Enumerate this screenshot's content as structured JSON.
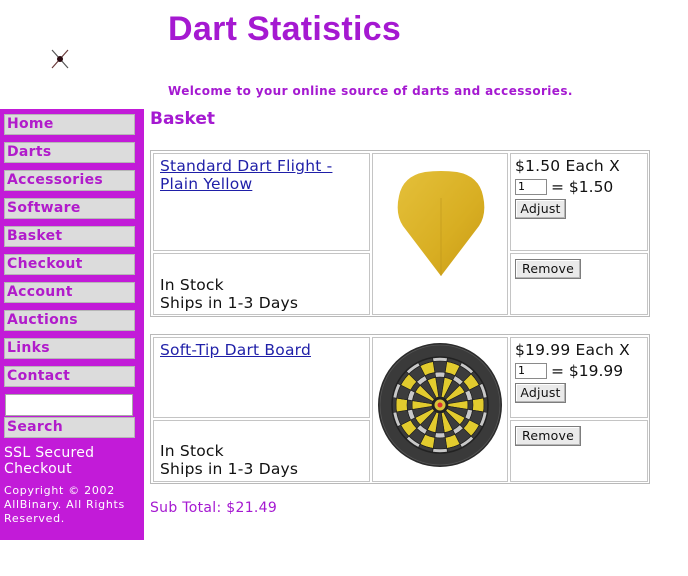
{
  "header": {
    "title": "Dart Statistics",
    "welcome": "Welcome to your online source of darts and accessories."
  },
  "sidebar": {
    "items": [
      {
        "label": "Home"
      },
      {
        "label": "Darts"
      },
      {
        "label": "Accessories"
      },
      {
        "label": "Software"
      },
      {
        "label": "Basket"
      },
      {
        "label": "Checkout"
      },
      {
        "label": "Account"
      },
      {
        "label": "Auctions"
      },
      {
        "label": "Links"
      },
      {
        "label": "Contact"
      }
    ],
    "search_value": "",
    "search_label": "Search",
    "ssl_text": "SSL Secured Checkout",
    "copyright": "Copyright © 2002 AllBinary. All Rights Reserved."
  },
  "main": {
    "heading": "Basket",
    "items": [
      {
        "name_line1": "Standard Dart Flight -",
        "name_line2": "Plain Yellow",
        "stock": "In Stock",
        "shipping": "Ships in 1-3 Days",
        "price_each": "$1.50 Each X",
        "quantity": "1",
        "line_total": "= $1.50",
        "adjust_label": "Adjust",
        "remove_label": "Remove",
        "image": "yellow-dart-flight"
      },
      {
        "name_line1": "Soft-Tip Dart Board",
        "name_line2": "",
        "stock": "In Stock",
        "shipping": "Ships in 1-3 Days",
        "price_each": "$19.99 Each X",
        "quantity": "1",
        "line_total": "= $19.99",
        "adjust_label": "Adjust",
        "remove_label": "Remove",
        "image": "soft-tip-dartboard"
      }
    ],
    "subtotal_label": "Sub Total:",
    "subtotal_value": "$21.49"
  },
  "colors": {
    "accent": "#a519d1",
    "sidebar_bg": "#c21bd8",
    "nav_button_bg": "#dcdcdc",
    "link": "#1f1fa8"
  }
}
